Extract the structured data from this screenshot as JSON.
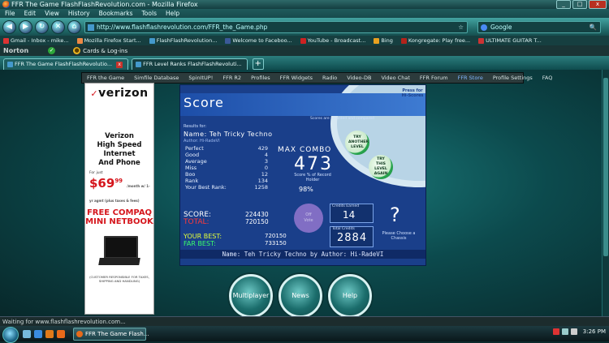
{
  "window": {
    "title": "FFR The Game FlashFlashRevolution.com - Mozilla Firefox",
    "buttons": [
      "_",
      "□",
      "x"
    ]
  },
  "menu": [
    "File",
    "Edit",
    "View",
    "History",
    "Bookmarks",
    "Tools",
    "Help"
  ],
  "nav": {
    "url": "http://www.flashflashrevolution.com/FFR_the_Game.php",
    "search_placeholder": "Google"
  },
  "bookmarks": [
    {
      "label": "Gmail - Inbox - mike...",
      "color": "#d33"
    },
    {
      "label": "Mozilla Firefox Start...",
      "color": "#e84"
    },
    {
      "label": "FlashFlashRevolution...",
      "color": "#49c"
    },
    {
      "label": "Welcome to Faceboo...",
      "color": "#3b5998"
    },
    {
      "label": "YouTube - Broadcast...",
      "color": "#c22"
    },
    {
      "label": "Bing",
      "color": "#e9a020"
    },
    {
      "label": "Kongregate: Play free...",
      "color": "#b3231b"
    },
    {
      "label": "ULTIMATE GUITAR T...",
      "color": "#c33"
    }
  ],
  "norton": {
    "logo": "Norton",
    "cards_label": "Cards & Log-ins"
  },
  "tabs": [
    {
      "label": "FFR The Game FlashFlashRevolutio...",
      "active": true
    },
    {
      "label": "FFR Level Ranks FlashFlashRevoluti...",
      "active": false
    }
  ],
  "site_nav": [
    "FFR the Game",
    "Simfile Database",
    "SpinItUP!",
    "FFR R2",
    "Profiles",
    "FFR Widgets",
    "Radio",
    "Video-DB",
    "Video Chat",
    "FFR Forum",
    "FFR Store",
    "Profile Settings",
    "FAQ"
  ],
  "ad": {
    "brand": "verizon",
    "headline_line1": "Verizon",
    "headline_line2": "High Speed Internet",
    "headline_line3": "And Phone",
    "for_just": "For just",
    "price": "$69",
    "price_cents": "99",
    "price_note": "/month w/ 1-yr agmt (plus taxes & fees)",
    "free_line1": "FREE COMPAQ",
    "free_line2": "MINI NETBOOK",
    "footnote": "(CUSTOMER RESPONSIBLE FOR TAXES, SHIPPING AND HANDLING)"
  },
  "game": {
    "heading": "Score",
    "press_for": "Press for Hi-Scores",
    "score_note": "Scores are recorded and compared",
    "results_for": "Results for:",
    "song_name": "Name: Teh Tricky Techno",
    "author_line": "Author: Hi-RadeVI",
    "stats": [
      {
        "label": "Perfect",
        "value": "429"
      },
      {
        "label": "Good",
        "value": "4"
      },
      {
        "label": "Average",
        "value": "3"
      },
      {
        "label": "Miss",
        "value": "0"
      },
      {
        "label": "Boo",
        "value": "12"
      },
      {
        "label": "Rank",
        "value": "134"
      }
    ],
    "your_best_rank_label": "Your Best Rank:",
    "your_best_rank": "1258",
    "max_combo_label": "MAX COMBO",
    "max_combo": "473",
    "combo_note": "Score % of Record Holder",
    "percent": "98%",
    "try_another": "TRY ANOTHER LEVEL",
    "try_again": "TRY THIS LEVEL AGAIN",
    "score_label": "SCORE:",
    "score_value": "224430",
    "total_label": "TOTAL:",
    "total_value": "720150",
    "your_best_label": "YOUR BEST:",
    "your_best_value": "720150",
    "far_best_label": "FAR BEST:",
    "far_best_value": "733150",
    "vote_label": "Vote",
    "vote_sub": "Off",
    "obtained_label": "Credits Earned",
    "obtained_value": "14",
    "total_credits_label": "Total Credits",
    "total_credits": "2884",
    "question": "?",
    "choose_text": "Please Choose a Chassis",
    "footer": "Name: Teh Tricky Techno by Author: Hi-RadeVI"
  },
  "big_buttons": [
    "Multiplayer",
    "News",
    "Help"
  ],
  "status": "Waiting for www.flashflashrevolution.com...",
  "taskbar": {
    "item": "FFR The Game Flash...",
    "time": "3:26 PM"
  }
}
